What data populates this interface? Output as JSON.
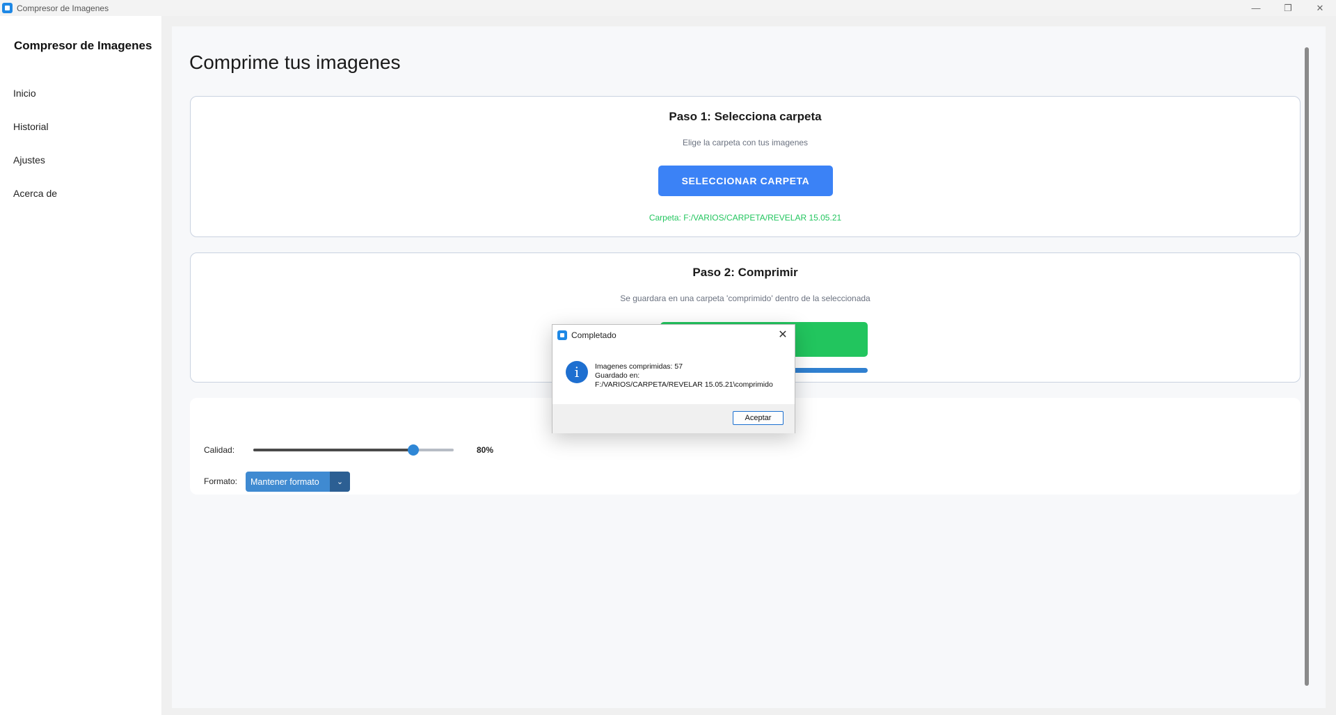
{
  "window": {
    "title": "Compresor de Imagenes",
    "controls": {
      "minimize": "—",
      "maximize": "❐",
      "close": "✕"
    }
  },
  "sidebar": {
    "brand": "Compresor de Imagenes",
    "items": [
      {
        "label": "Inicio"
      },
      {
        "label": "Historial"
      },
      {
        "label": "Ajustes"
      },
      {
        "label": "Acerca de"
      }
    ]
  },
  "main": {
    "page_title": "Comprime tus imagenes",
    "step1": {
      "title": "Paso 1: Selecciona carpeta",
      "subtitle": "Elige la carpeta con tus imagenes",
      "button_label": "SELECCIONAR CARPETA",
      "folder_text": "Carpeta: F:/VARIOS/CARPETA/REVELAR 15.05.21"
    },
    "step2": {
      "title": "Paso 2: Comprimir",
      "subtitle": "Se guardara en una carpeta 'comprimido' dentro de la seleccionada",
      "progress": 1.0
    },
    "config": {
      "title_visible": "on",
      "quality_label": "Calidad:",
      "quality_value": 80,
      "quality_text": "80%",
      "format_label": "Formato:",
      "format_selected": "Mantener formato",
      "arrow": "⌄"
    }
  },
  "dialog": {
    "title": "Completado",
    "close": "✕",
    "info_glyph": "i",
    "lines": [
      "Imagenes comprimidas: 57",
      "Guardado en:",
      "F:/VARIOS/CARPETA/REVELAR 15.05.21\\comprimido"
    ],
    "ok_label": "Aceptar"
  },
  "colors": {
    "primary": "#3b82f6",
    "success": "#22c55e",
    "slider": "#2f87d6",
    "select": "#3f8ad1"
  }
}
